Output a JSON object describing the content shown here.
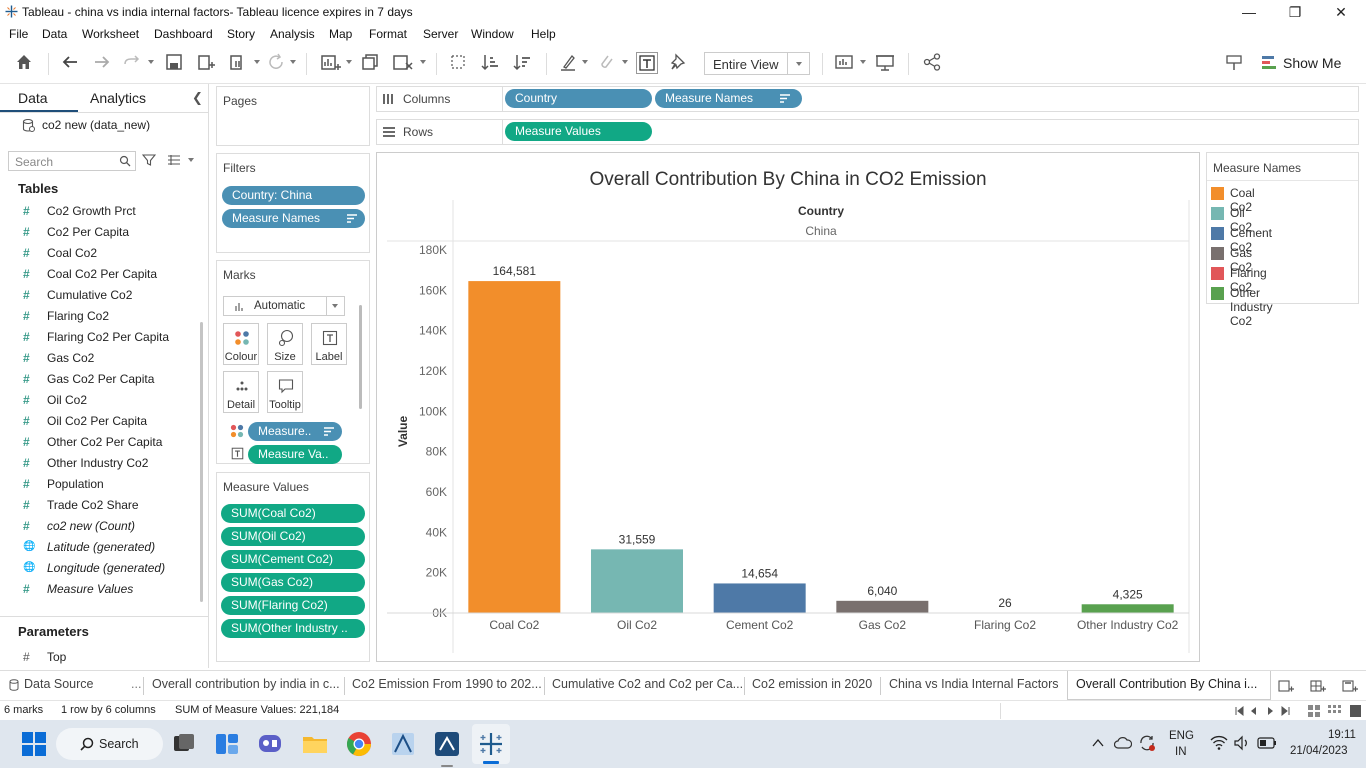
{
  "window": {
    "title": "Tableau - china vs india internal factors- Tableau licence expires in 7 days"
  },
  "menu": [
    "File",
    "Data",
    "Worksheet",
    "Dashboard",
    "Story",
    "Analysis",
    "Map",
    "Format",
    "Server",
    "Window",
    "Help"
  ],
  "toolbar": {
    "view_mode": "Entire View",
    "show_me": "Show Me"
  },
  "data_pane": {
    "tab_data": "Data",
    "tab_analytics": "Analytics",
    "datasource": "co2 new (data_new)",
    "search_placeholder": "Search",
    "tables_heading": "Tables",
    "fields": [
      {
        "name": "Co2 Growth Prct",
        "italic": false,
        "type": "measure"
      },
      {
        "name": "Co2 Per Capita",
        "italic": false,
        "type": "measure"
      },
      {
        "name": "Coal Co2",
        "italic": false,
        "type": "measure"
      },
      {
        "name": "Coal Co2 Per Capita",
        "italic": false,
        "type": "measure"
      },
      {
        "name": "Cumulative Co2",
        "italic": false,
        "type": "measure"
      },
      {
        "name": "Flaring Co2",
        "italic": false,
        "type": "measure"
      },
      {
        "name": "Flaring Co2 Per Capita",
        "italic": false,
        "type": "measure"
      },
      {
        "name": "Gas Co2",
        "italic": false,
        "type": "measure"
      },
      {
        "name": "Gas Co2 Per Capita",
        "italic": false,
        "type": "measure"
      },
      {
        "name": "Oil Co2",
        "italic": false,
        "type": "measure"
      },
      {
        "name": "Oil Co2 Per Capita",
        "italic": false,
        "type": "measure"
      },
      {
        "name": "Other Co2 Per Capita",
        "italic": false,
        "type": "measure"
      },
      {
        "name": "Other Industry Co2",
        "italic": false,
        "type": "measure"
      },
      {
        "name": "Population",
        "italic": false,
        "type": "measure"
      },
      {
        "name": "Trade Co2 Share",
        "italic": false,
        "type": "measure"
      },
      {
        "name": "co2 new (Count)",
        "italic": true,
        "type": "measure"
      },
      {
        "name": "Latitude (generated)",
        "italic": true,
        "type": "geo"
      },
      {
        "name": "Longitude (generated)",
        "italic": true,
        "type": "geo"
      },
      {
        "name": "Measure Values",
        "italic": true,
        "type": "measure"
      }
    ],
    "parameters_heading": "Parameters",
    "parameters": [
      {
        "name": "Top"
      }
    ]
  },
  "shelves": {
    "pages": "Pages",
    "columns_label": "Columns",
    "rows_label": "Rows",
    "columns": [
      "Country",
      "Measure Names"
    ],
    "rows": [
      "Measure Values"
    ],
    "filters_label": "Filters",
    "filters": [
      "Country: China",
      "Measure Names"
    ],
    "marks_label": "Marks",
    "mark_type": "Automatic",
    "mark_buttons": [
      "Colour",
      "Size",
      "Label",
      "Detail",
      "Tooltip"
    ],
    "mark_pills": [
      "Measure..",
      "Measure Va.."
    ],
    "measure_values_label": "Measure Values",
    "measure_values": [
      "SUM(Coal Co2)",
      "SUM(Oil Co2)",
      "SUM(Cement Co2)",
      "SUM(Gas Co2)",
      "SUM(Flaring Co2)",
      "SUM(Other Industry .."
    ]
  },
  "chart_data": {
    "type": "bar",
    "title": "Overall Contribution By China in CO2 Emission",
    "column_header": "Country",
    "column_value": "China",
    "ylabel": "Value",
    "ylim": [
      0,
      180000
    ],
    "yticks": [
      0,
      20000,
      40000,
      60000,
      80000,
      100000,
      120000,
      140000,
      160000,
      180000
    ],
    "ytick_labels": [
      "0K",
      "20K",
      "40K",
      "60K",
      "80K",
      "100K",
      "120K",
      "140K",
      "160K",
      "180K"
    ],
    "categories": [
      "Coal Co2",
      "Oil Co2",
      "Cement Co2",
      "Gas Co2",
      "Flaring Co2",
      "Other Industry Co2"
    ],
    "values": [
      164581,
      31559,
      14654,
      6040,
      26,
      4325
    ],
    "value_labels": [
      "164,581",
      "31,559",
      "14,654",
      "6,040",
      "26",
      "4,325"
    ],
    "colors": [
      "#f28e2b",
      "#76b7b2",
      "#4e79a7",
      "#79706e",
      "#e15759",
      "#59a14f"
    ]
  },
  "legend": {
    "title": "Measure Names",
    "items": [
      {
        "label": "Coal Co2",
        "color": "#f28e2b"
      },
      {
        "label": "Oil Co2",
        "color": "#76b7b2"
      },
      {
        "label": "Cement Co2",
        "color": "#4e79a7"
      },
      {
        "label": "Gas Co2",
        "color": "#79706e"
      },
      {
        "label": "Flaring Co2",
        "color": "#e15759"
      },
      {
        "label": "Other Industry Co2",
        "color": "#59a14f"
      }
    ]
  },
  "sheet_tabs": {
    "datasource": "Data Source",
    "tabs": [
      "Overall contribution by india in c...",
      "Co2 Emission From 1990 to 202...",
      "Cumulative Co2 and Co2 per Ca...",
      "Co2 emission in 2020",
      "China vs India Internal Factors",
      "Overall Contribution By China i..."
    ],
    "active_index": 5
  },
  "status": {
    "marks": "6 marks",
    "layout": "1 row by 6 columns",
    "sum": "SUM of Measure Values: 221,184"
  },
  "taskbar": {
    "search": "Search",
    "lang1": "ENG",
    "lang2": "IN",
    "time": "19:11",
    "date": "21/04/2023"
  }
}
